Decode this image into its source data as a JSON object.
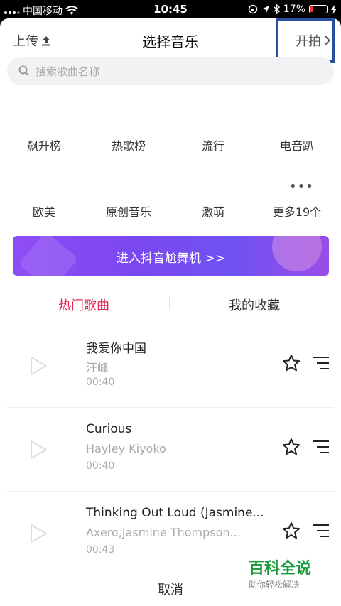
{
  "status_bar": {
    "carrier": "中国移动",
    "time": "10:45",
    "battery": "17%",
    "battery_level": 0.17
  },
  "header": {
    "upload_label": "上传",
    "title": "选择音乐",
    "start_label": "开拍"
  },
  "search": {
    "placeholder": "搜索歌曲名称"
  },
  "categories": [
    "飙升榜",
    "热歌榜",
    "流行",
    "电音趴",
    "欧美",
    "原创音乐",
    "激萌",
    "更多19个"
  ],
  "banner": {
    "label": "进入抖音尬舞机 >>"
  },
  "tabs": {
    "hot": "热门歌曲",
    "favorites": "我的收藏"
  },
  "songs": [
    {
      "name": "我爱你中国",
      "artist": "汪峰",
      "duration": "00:40"
    },
    {
      "name": "Curious",
      "artist": "Hayley Kiyoko",
      "duration": "00:40"
    },
    {
      "name": "Thinking Out Loud (Jasmine...",
      "artist": "Axero,Jasmine Thompson...",
      "duration": "00:43"
    }
  ],
  "watermark": {
    "main": "百科全说",
    "sub": "助你轻松解决"
  },
  "footer": {
    "cancel_label": "取消"
  },
  "colors": {
    "accent": "#e0264f",
    "banner_start": "#8f4cf5",
    "highlight": "#2b4fa0"
  }
}
